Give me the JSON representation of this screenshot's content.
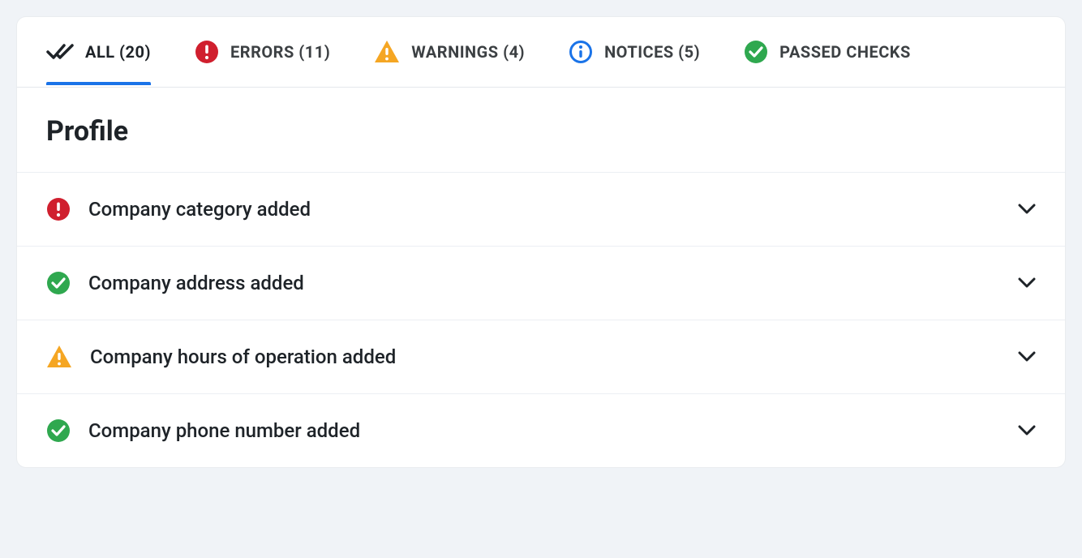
{
  "tabs": [
    {
      "key": "all",
      "label": "ALL (20)",
      "icon": "double-check",
      "active": true
    },
    {
      "key": "errors",
      "label": "ERRORS (11)",
      "icon": "error",
      "active": false
    },
    {
      "key": "warnings",
      "label": "WARNINGS (4)",
      "icon": "warning",
      "active": false
    },
    {
      "key": "notices",
      "label": "NOTICES (5)",
      "icon": "notice",
      "active": false
    },
    {
      "key": "passed",
      "label": "PASSED CHECKS",
      "icon": "passed",
      "active": false
    }
  ],
  "section": {
    "title": "Profile"
  },
  "items": [
    {
      "label": "Company category added",
      "status": "error"
    },
    {
      "label": "Company address added",
      "status": "passed"
    },
    {
      "label": "Company hours of operation added",
      "status": "warning"
    },
    {
      "label": "Company phone number added",
      "status": "passed"
    }
  ],
  "colors": {
    "error": "#d01f2e",
    "warning": "#f5a623",
    "notice": "#1a73e8",
    "passed": "#2fa84f",
    "text": "#1e2328"
  }
}
